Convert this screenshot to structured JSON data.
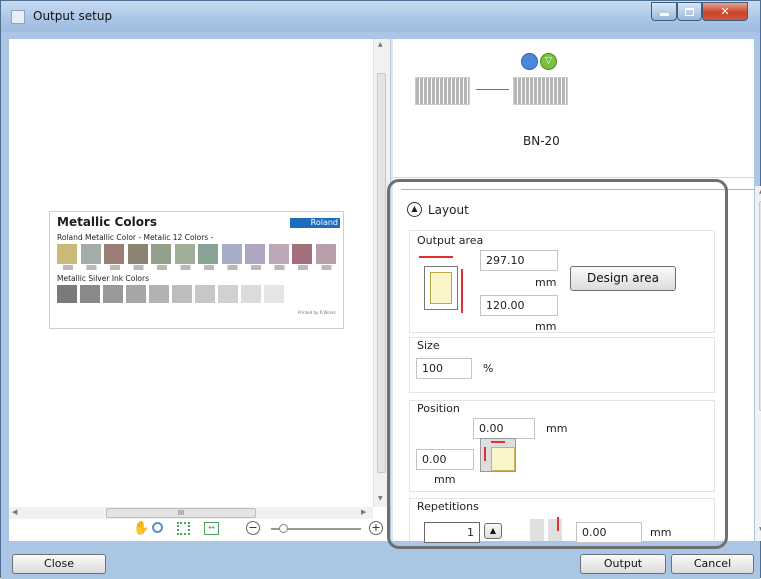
{
  "window": {
    "title": "Output setup"
  },
  "preview": {
    "card_title": "Metallic Colors",
    "brand": "Roland",
    "subtitle": "Roland Metallic Color  - Metalic 12 Colors -",
    "silver_title": "Metallic Silver Ink Colors",
    "printed_by": "Printed by R.Works",
    "swatch_colors": [
      "#c9ba78",
      "#a4aca7",
      "#9a7e76",
      "#8c8472",
      "#93a18b",
      "#a1af9a",
      "#8aa295",
      "#a7adc4",
      "#aea6c1",
      "#bca7b6",
      "#a2707a",
      "#b79eaa"
    ],
    "silver_colors": [
      "#7a7a7a",
      "#8a8a8a",
      "#999999",
      "#a6a6a6",
      "#b2b2b2",
      "#bdbdbd",
      "#c7c7c7",
      "#d1d1d1",
      "#dbdbdb",
      "#e5e5e5"
    ]
  },
  "job": {
    "name": "BN-20"
  },
  "layout": {
    "section_label": "Layout",
    "output_area": {
      "label": "Output area",
      "width_value": "297.10",
      "width_unit": "mm",
      "height_value": "120.00",
      "height_unit": "mm",
      "design_area_button": "Design area"
    },
    "size": {
      "label": "Size",
      "value": "100",
      "unit": "%"
    },
    "position": {
      "label": "Position",
      "x_value": "0.00",
      "x_unit": "mm",
      "y_value": "0.00",
      "y_unit": "mm"
    },
    "repetitions": {
      "label": "Repetitions",
      "count": "1",
      "spacing_value": "0.00",
      "spacing_unit": "mm"
    }
  },
  "buttons": {
    "close": "Close",
    "output": "Output",
    "cancel": "Cancel"
  },
  "scroll": {
    "hthumb_grip": "III"
  }
}
